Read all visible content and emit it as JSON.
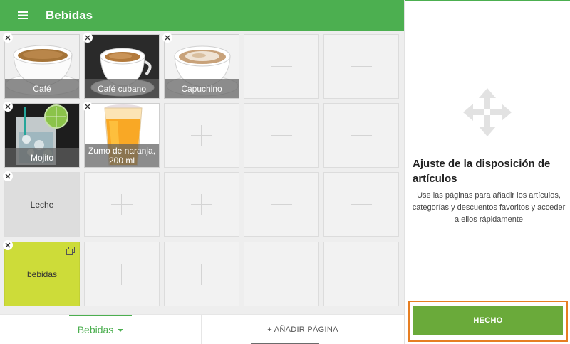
{
  "header": {
    "title": "Bebidas",
    "menu_icon": "hamburger-menu-icon",
    "color": "#4caf50"
  },
  "grid": {
    "rows": [
      [
        {
          "type": "photo",
          "label": "Café",
          "remove_icon": "close-icon"
        },
        {
          "type": "photo",
          "label": "Café cubano",
          "remove_icon": "close-icon"
        },
        {
          "type": "photo",
          "label": "Capuchino",
          "remove_icon": "close-icon"
        },
        {
          "type": "empty",
          "icon": "plus-icon"
        },
        {
          "type": "empty",
          "icon": "plus-icon"
        }
      ],
      [
        {
          "type": "photo",
          "label": "Mojito",
          "remove_icon": "close-icon"
        },
        {
          "type": "photo",
          "label": "Zumo de naranja, 200 ml",
          "remove_icon": "close-icon"
        },
        {
          "type": "empty",
          "icon": "plus-icon"
        },
        {
          "type": "empty",
          "icon": "plus-icon"
        },
        {
          "type": "empty",
          "icon": "plus-icon"
        }
      ],
      [
        {
          "type": "color",
          "label": "Leche",
          "color": "#dddddd",
          "remove_icon": "close-icon"
        },
        {
          "type": "empty",
          "icon": "plus-icon"
        },
        {
          "type": "empty",
          "icon": "plus-icon"
        },
        {
          "type": "empty",
          "icon": "plus-icon"
        },
        {
          "type": "empty",
          "icon": "plus-icon"
        }
      ],
      [
        {
          "type": "category",
          "label": "bebidas",
          "color": "#cddc39",
          "remove_icon": "close-icon",
          "badge_icon": "copy-icon"
        },
        {
          "type": "empty",
          "icon": "plus-icon"
        },
        {
          "type": "empty",
          "icon": "plus-icon"
        },
        {
          "type": "empty",
          "icon": "plus-icon"
        },
        {
          "type": "empty",
          "icon": "plus-icon"
        }
      ]
    ]
  },
  "footer": {
    "page_tab": "Bebidas",
    "add_page": "+ AÑADIR PÁGINA",
    "accent": "#4caf50"
  },
  "help": {
    "icon": "move-arrows-icon",
    "title": "Ajuste de la disposición de artículos",
    "text": "Use las páginas para añadir los artículos, categorías y descuentos favoritos y acceder a ellos rápidamente",
    "done_label": "HECHO",
    "done_color": "#6aaa3a",
    "highlight_color": "#e67e22"
  }
}
